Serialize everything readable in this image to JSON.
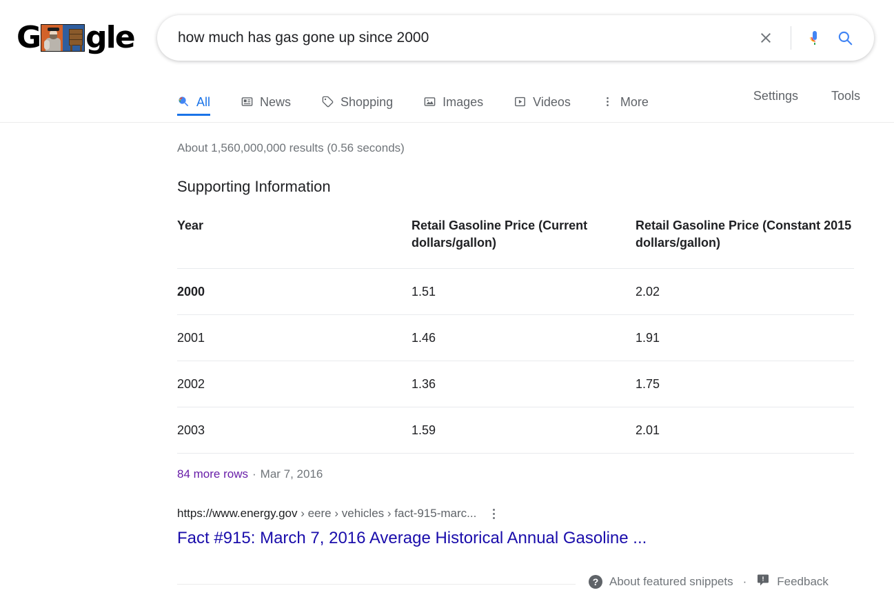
{
  "logo": {
    "letters_before": "G",
    "letters_after": "gle",
    "doodle_alt": "google-doodle-image"
  },
  "search": {
    "query": "how much has gas gone up since 2000",
    "placeholder": "Search",
    "clear_icon": "close-icon",
    "mic_icon": "microphone-icon",
    "search_icon": "search-icon"
  },
  "nav": {
    "tabs": [
      {
        "label": "All",
        "icon": "search-icon",
        "active": true
      },
      {
        "label": "News",
        "icon": "news-icon",
        "active": false
      },
      {
        "label": "Shopping",
        "icon": "tag-icon",
        "active": false
      },
      {
        "label": "Images",
        "icon": "image-icon",
        "active": false
      },
      {
        "label": "Videos",
        "icon": "video-icon",
        "active": false
      },
      {
        "label": "More",
        "icon": "more-vertical-icon",
        "active": false
      }
    ],
    "settings_label": "Settings",
    "tools_label": "Tools"
  },
  "results": {
    "count_text": "About 1,560,000,000 results (0.56 seconds)"
  },
  "snippet": {
    "heading": "Supporting Information",
    "table": {
      "headers": [
        "Year",
        "Retail Gasoline Price (Current dollars/gallon)",
        "Retail Gasoline Price (Constant 2015 dollars/gallon)"
      ],
      "rows": [
        {
          "year": "2000",
          "current": "1.51",
          "constant": "2.02",
          "highlight": true
        },
        {
          "year": "2001",
          "current": "1.46",
          "constant": "1.91",
          "highlight": false
        },
        {
          "year": "2002",
          "current": "1.36",
          "constant": "1.75",
          "highlight": false
        },
        {
          "year": "2003",
          "current": "1.59",
          "constant": "2.01",
          "highlight": false
        }
      ]
    },
    "more_rows_label": "84 more rows",
    "separator": "·",
    "date": "Mar 7, 2016"
  },
  "result": {
    "url_domain": "https://www.energy.gov",
    "url_path": " › eere › vehicles › fact-915-marc...",
    "menu_icon": "kebab-menu-icon",
    "title": "Fact #915: March 7, 2016 Average Historical Annual Gasoline ..."
  },
  "footer": {
    "about_icon": "help-circle-icon",
    "about_label": "About featured snippets",
    "separator": "·",
    "feedback_icon": "feedback-icon",
    "feedback_label": "Feedback"
  },
  "chart_data": {
    "type": "table",
    "title": "Supporting Information",
    "columns": [
      "Year",
      "Retail Gasoline Price (Current dollars/gallon)",
      "Retail Gasoline Price (Constant 2015 dollars/gallon)"
    ],
    "rows": [
      [
        "2000",
        1.51,
        2.02
      ],
      [
        "2001",
        1.46,
        1.91
      ],
      [
        "2002",
        1.36,
        1.75
      ],
      [
        "2003",
        1.59,
        2.01
      ]
    ],
    "note": "84 more rows",
    "source_date": "Mar 7, 2016"
  },
  "colors": {
    "link_blue": "#1a0dab",
    "visited_purple": "#681da8",
    "accent_blue": "#1a73e8",
    "text_gray": "#70757a",
    "text_dark": "#202124"
  }
}
